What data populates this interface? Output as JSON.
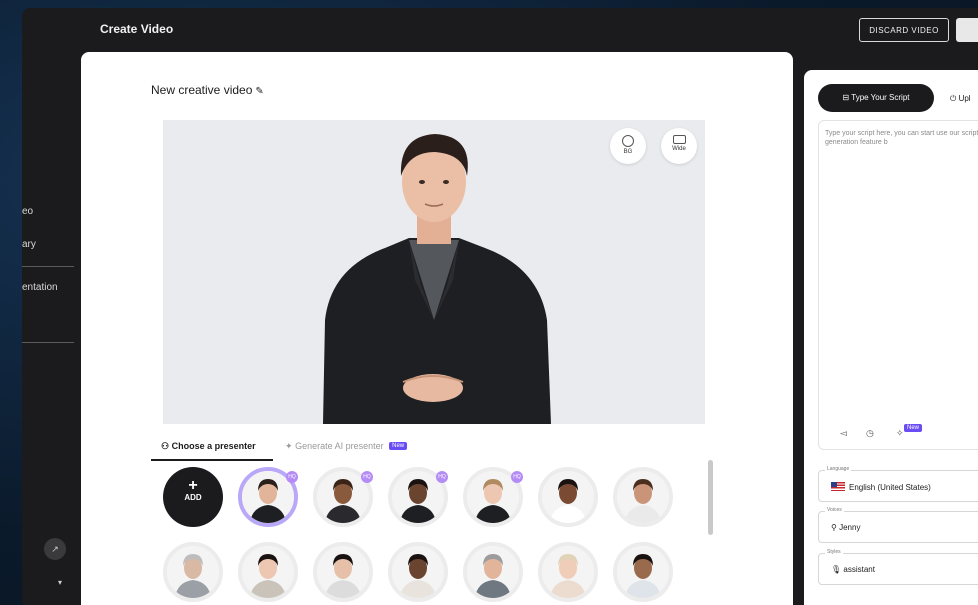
{
  "topbar": {
    "title": "Create Video",
    "discard_label": "DISCARD VIDEO"
  },
  "sidebar": {
    "items": [
      {
        "label": "eo"
      },
      {
        "label": "ary"
      },
      {
        "label": "entation"
      }
    ]
  },
  "editor": {
    "video_title": "New creative video",
    "controls": {
      "bg_label": "BG",
      "wide_label": "Wide"
    }
  },
  "presenters": {
    "tabs": [
      {
        "label": "Choose a presenter"
      },
      {
        "label": "Generate AI presenter",
        "badge": "New"
      }
    ],
    "add_label": "ADD",
    "hq_badge": "HQ"
  },
  "script_panel": {
    "tabs": [
      {
        "label": "Type Your Script"
      },
      {
        "label": "Upl"
      }
    ],
    "placeholder": "Type your script here, you can start use our script-generation feature b",
    "tool_badge": "New",
    "language": {
      "label": "Language",
      "value": "English (United States)"
    },
    "voices": {
      "label": "Voices",
      "value": "Jenny"
    },
    "styles": {
      "label": "Styles",
      "value": "assistant"
    }
  },
  "colors": {
    "accent": "#6a4cf5",
    "dark": "#1b1b1d",
    "preview_bg": "#e9ebee",
    "hq_badge": "#b58cf5"
  }
}
